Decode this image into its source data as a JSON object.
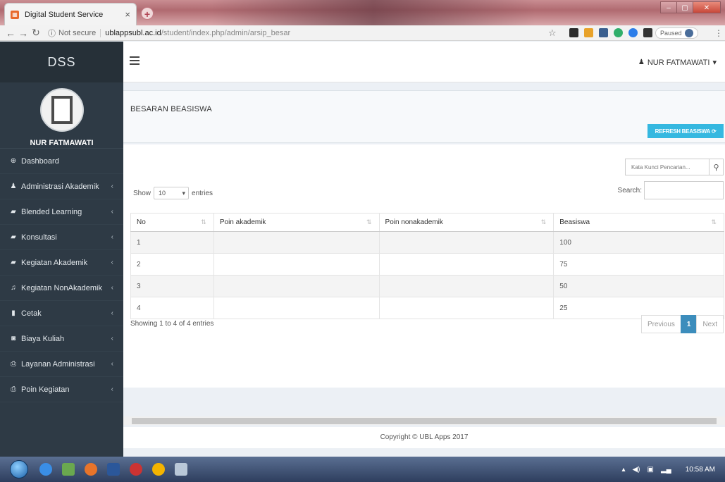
{
  "browser": {
    "tab_title": "Digital Student Service",
    "tab_close": "×",
    "new_tab": "+",
    "not_secure": "Not secure",
    "url_host": "ublappsubl.ac.id",
    "url_path": "/student/index.php/admin/arsip_besar",
    "profile_status": "Paused"
  },
  "sidebar": {
    "brand": "DSS",
    "user_name": "NUR FATMAWATI",
    "items": [
      {
        "label": "Dashboard",
        "icon": "dashboard-icon",
        "glyph": "⊕",
        "has_submenu": false
      },
      {
        "label": "Administrasi Akademik",
        "icon": "user-icon",
        "glyph": "♟",
        "has_submenu": true
      },
      {
        "label": "Blended Learning",
        "icon": "book-icon",
        "glyph": "▰",
        "has_submenu": true
      },
      {
        "label": "Konsultasi",
        "icon": "video-icon",
        "glyph": "▰",
        "has_submenu": true
      },
      {
        "label": "Kegiatan Akademik",
        "icon": "book-icon",
        "glyph": "▰",
        "has_submenu": true
      },
      {
        "label": "Kegiatan NonAkademik",
        "icon": "music-icon",
        "glyph": "♫",
        "has_submenu": true
      },
      {
        "label": "Cetak",
        "icon": "file-icon",
        "glyph": "▮",
        "has_submenu": true
      },
      {
        "label": "Biaya Kuliah",
        "icon": "money-icon",
        "glyph": "◙",
        "has_submenu": true
      },
      {
        "label": "Layanan Administrasi",
        "icon": "print-icon",
        "glyph": "⎙",
        "has_submenu": true
      },
      {
        "label": "Poin Kegiatan",
        "icon": "print-icon",
        "glyph": "⎙",
        "has_submenu": true
      }
    ]
  },
  "navbar": {
    "user_label": "NUR FATMAWATI"
  },
  "page": {
    "title": "BESARAN BEASISWA",
    "refresh_label": "REFRESH BEASISWA",
    "keyword_placeholder": "Kata Kunci Pencarian..."
  },
  "table": {
    "show_label": "Show",
    "entries_value": "10",
    "entries_label": "entries",
    "search_label": "Search:",
    "columns": [
      "No",
      "Poin akademik",
      "Poin nonakademik",
      "Beasiswa"
    ],
    "rows": [
      [
        "1",
        "",
        "",
        "100"
      ],
      [
        "2",
        "",
        "",
        "75"
      ],
      [
        "3",
        "",
        "",
        "50"
      ],
      [
        "4",
        "",
        "",
        "25"
      ]
    ],
    "info": "Showing 1 to 4 of 4 entries",
    "pagination": {
      "previous": "Previous",
      "current": "1",
      "next": "Next"
    }
  },
  "footer": {
    "copyright": "Copyright © UBL Apps 2017"
  },
  "taskbar": {
    "clock": "10:58 AM"
  }
}
